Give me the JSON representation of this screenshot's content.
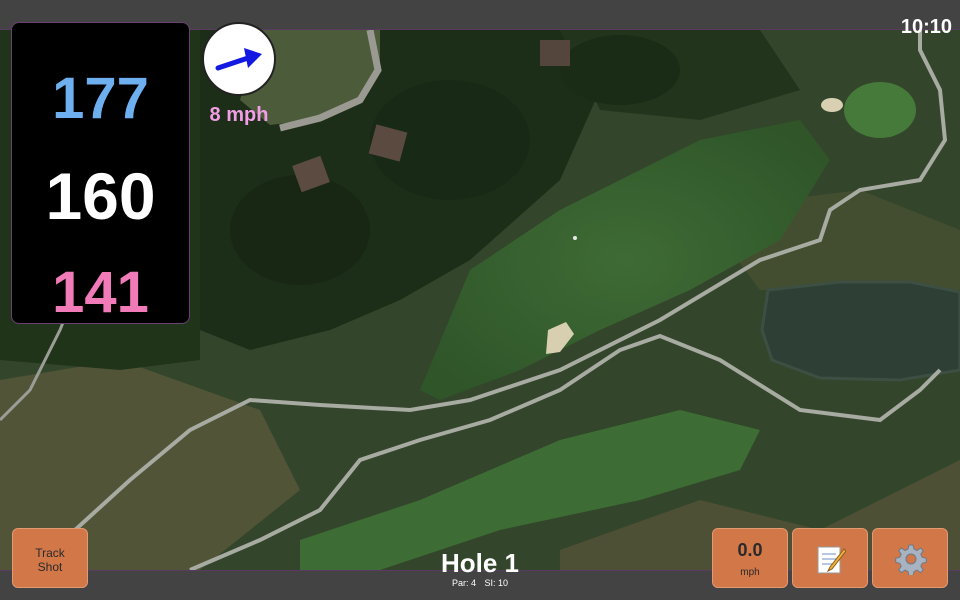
{
  "status_bar": {
    "time": "10:10"
  },
  "distances": {
    "back": "177",
    "center": "160",
    "front": "141"
  },
  "wind": {
    "speed_label": "8 mph",
    "direction_icon": "arrow-up-right-icon"
  },
  "hole": {
    "title": "Hole 1",
    "par_label": "Par: 4",
    "si_label": "SI: 10"
  },
  "buttons": {
    "track_shot": "Track Shot",
    "speed_value": "0.0",
    "speed_unit": "mph",
    "notes_icon": "notepad-icon",
    "settings_icon": "gear-icon"
  },
  "colors": {
    "back_distance": "#6eb0ef",
    "center_distance": "#ffffff",
    "front_distance": "#f17ab8",
    "wind_speed": "#f29ee6",
    "button": "#d27748"
  }
}
